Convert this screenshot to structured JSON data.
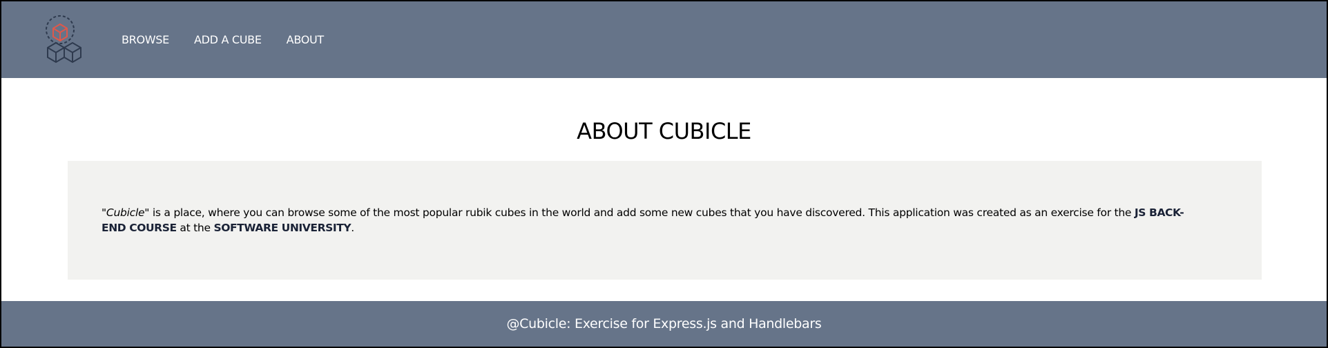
{
  "colors": {
    "header_bg": "#667489",
    "footer_bg": "#667489",
    "panel_bg": "#f2f2f0",
    "logo_accent": "#e0584a",
    "logo_dark": "#2e3a4e"
  },
  "header": {
    "logo_icon": "cubes-logo-icon",
    "nav": {
      "browse": "BROWSE",
      "add_cube": "ADD A CUBE",
      "about": "ABOUT"
    }
  },
  "main": {
    "title": "ABOUT CUBICLE",
    "paragraph": {
      "italic_name": "\"Cubicle\"",
      "text_1": " is a place, where you can browse some of the most popular rubik cubes in the world and add some new cubes that you have discovered. This application was created as an exercise for the ",
      "course": "JS BACK-END COURSE",
      "text_2": " at the ",
      "university": "SOFTWARE UNIVERSITY",
      "text_3": "."
    }
  },
  "footer": {
    "text": "@Cubicle: Exercise for Express.js and Handlebars"
  }
}
